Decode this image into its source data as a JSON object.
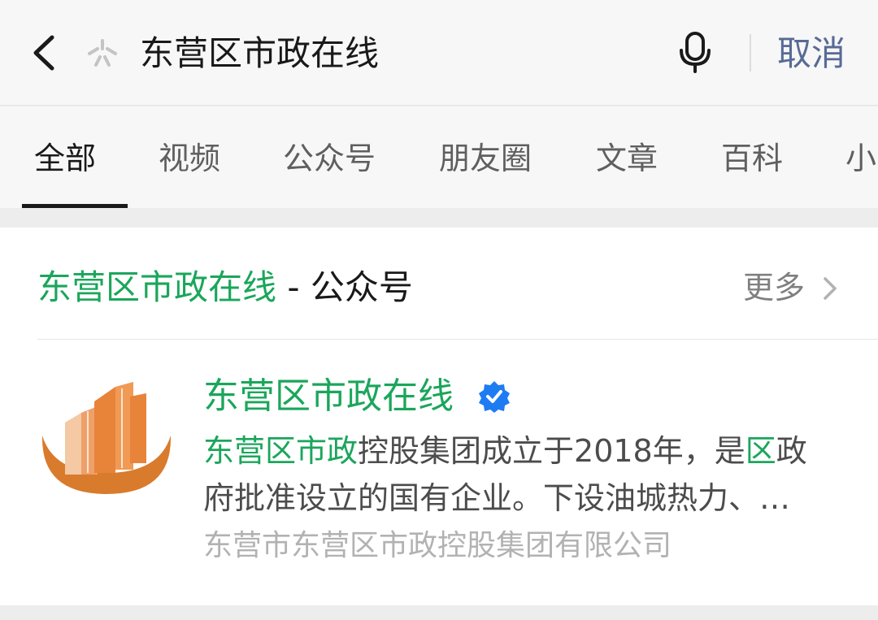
{
  "search": {
    "query": "东营区市政在线",
    "cancel_label": "取消",
    "icons": {
      "back": "back-chevron-icon",
      "search": "search-spark-icon",
      "mic": "microphone-icon"
    }
  },
  "tabs": [
    {
      "label": "全部",
      "active": true
    },
    {
      "label": "视频",
      "active": false
    },
    {
      "label": "公众号",
      "active": false
    },
    {
      "label": "朋友圈",
      "active": false
    },
    {
      "label": "文章",
      "active": false
    },
    {
      "label": "百科",
      "active": false
    },
    {
      "label": "小",
      "active": false
    }
  ],
  "section": {
    "title_highlight": "东营区市政在线",
    "title_suffix": " - 公众号",
    "more_label": "更多"
  },
  "account": {
    "name": "东营区市政在线",
    "verified": true,
    "desc_line1_highlight": "东营区市政",
    "desc_line1_rest": "控股集团成立于2018年，是",
    "desc_line1_highlight2": "区",
    "desc_line1_end": "政",
    "desc_line2": "府批准设立的国有企业。下设油城热力、…",
    "company": "东营市东营区市政控股集团有限公司"
  },
  "colors": {
    "highlight_green": "#1ba65b",
    "link_blue": "#576b95",
    "verified_blue": "#1e7cf2",
    "logo_orange": "#e8833a"
  }
}
